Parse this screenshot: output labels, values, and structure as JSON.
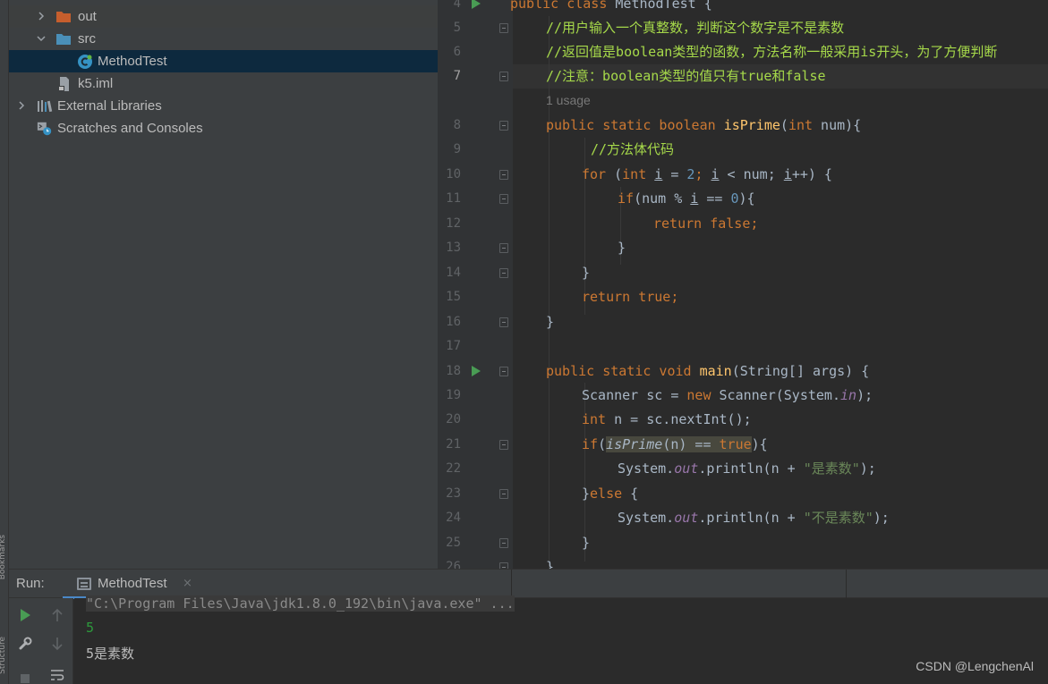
{
  "sidebar": {
    "bookmarks_label": "Bookmarks",
    "structure_label": "Structure"
  },
  "project_tree": {
    "items": [
      {
        "label": "out",
        "expanded": false,
        "icon": "folder-icon"
      },
      {
        "label": "src",
        "expanded": true,
        "icon": "source-folder-icon"
      },
      {
        "label": "MethodTest",
        "icon": "java-class-icon",
        "selected": true
      },
      {
        "label": "k5.iml",
        "icon": "module-file-icon"
      },
      {
        "label": "External Libraries",
        "expanded": false,
        "icon": "libraries-icon"
      },
      {
        "label": "Scratches and Consoles",
        "icon": "scratches-icon"
      }
    ]
  },
  "editor": {
    "usage_hint": "1 usage",
    "current_line": "7",
    "line_numbers": [
      "4",
      "5",
      "6",
      "7",
      "8",
      "9",
      "10",
      "11",
      "12",
      "13",
      "14",
      "15",
      "16",
      "17",
      "18",
      "19",
      "20",
      "21",
      "22",
      "23",
      "24",
      "25",
      "26"
    ],
    "code": {
      "class_kw": "public class ",
      "class_name": "MethodTest {",
      "c5": "//用户输入一个真整数，判断这个数字是不是素数",
      "c6": "//返回值是boolean类型的函数，方法名称一般采用is开头，为了方便判断",
      "c7": "//注意：boolean类型的值只有true和false",
      "l8_kw": "public static boolean ",
      "l8_fn": "isPrime",
      "l8_p": "(",
      "l8_int": "int",
      "l8_rest": " num){",
      "c9": "//方法体代码",
      "l10_for": "for ",
      "l10_p1": "(",
      "l10_int": "int ",
      "l10_i1": "i",
      "l10_eq": " = ",
      "l10_2": "2",
      "l10_semi1": "; ",
      "l10_i2": "i",
      "l10_lt": " < num; ",
      "l10_i3": "i",
      "l10_end": "++) {",
      "l11_if": "if",
      "l11_a": "(num % ",
      "l11_i": "i",
      "l11_b": " == ",
      "l11_0": "0",
      "l11_c": "){",
      "l12_ret": "return ",
      "l12_false": "false;",
      "brace": "}",
      "l15_ret": "return ",
      "l15_true": "true;",
      "l18_kw": "public static void ",
      "l18_fn": "main",
      "l18_rest": "(String[] args) {",
      "l19_a": "Scanner sc = ",
      "l19_new": "new ",
      "l19_b": "Scanner(System.",
      "l19_in": "in",
      "l19_c": ");",
      "l20_int": "int ",
      "l20_rest": "n = sc.nextInt();",
      "l21_if": "if",
      "l21_p": "(",
      "l21_fn": "isPrime",
      "l21_n": "(n) == ",
      "l21_true": "true",
      "l21_end": "){",
      "l22_a": "System.",
      "l22_out": "out",
      "l22_b": ".println(n + ",
      "l22_str": "\"是素数\"",
      "l22_c": ");",
      "l23_brace": "}",
      "l23_else": "else",
      "l23_b": " {",
      "l24_a": "System.",
      "l24_out": "out",
      "l24_b": ".println(n + ",
      "l24_str": "\"不是素数\"",
      "l24_c": ");"
    }
  },
  "run_panel": {
    "label": "Run:",
    "tab_label": "MethodTest",
    "close_glyph": "×",
    "console": [
      "\"C:\\Program Files\\Java\\jdk1.8.0_192\\bin\\java.exe\" ...",
      "5",
      "5是素数"
    ]
  },
  "watermark": "CSDN @LengchenAl",
  "colors": {
    "keyword": "#cc7832",
    "comment": "#a6d94a",
    "function": "#ffc66d",
    "number": "#6897bb",
    "string": "#6a8759",
    "field": "#9876aa",
    "user_input": "#2d9a3c",
    "run_green": "#499c54"
  }
}
